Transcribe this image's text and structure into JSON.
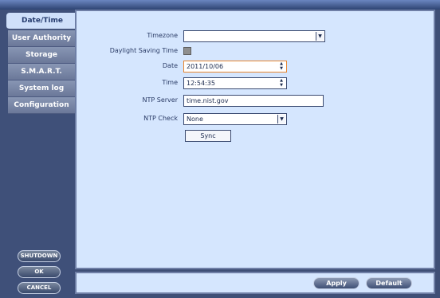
{
  "sidebar": {
    "tabs": [
      {
        "label": "Date/Time"
      },
      {
        "label": "User Authority"
      },
      {
        "label": "Storage"
      },
      {
        "label": "S.M.A.R.T."
      },
      {
        "label": "System log"
      },
      {
        "label": "Configuration"
      }
    ],
    "buttons": {
      "shutdown": "SHUTDOWN",
      "ok": "OK",
      "cancel": "CANCEL"
    }
  },
  "form": {
    "timezone": {
      "label": "Timezone",
      "value": ""
    },
    "daylight_saving": {
      "label": "Daylight Saving Time",
      "checked": false
    },
    "date": {
      "label": "Date",
      "value": "2011/10/06"
    },
    "time": {
      "label": "Time",
      "value": "12:54:35"
    },
    "ntp_server": {
      "label": "NTP Server",
      "value": "time.nist.gov"
    },
    "ntp_check": {
      "label": "NTP Check",
      "value": "None"
    },
    "sync_label": "Sync"
  },
  "footer": {
    "apply_label": "Apply",
    "default_label": "Default"
  },
  "colors": {
    "panel_bg": "#d5e6fe",
    "frame": "#3f4f76",
    "active_tab": "#cfe0fa",
    "highlight_border": "#e7852f"
  },
  "icons": {
    "dropdown": "chevron-down-icon",
    "spinner": "up-down-arrow-icon"
  }
}
